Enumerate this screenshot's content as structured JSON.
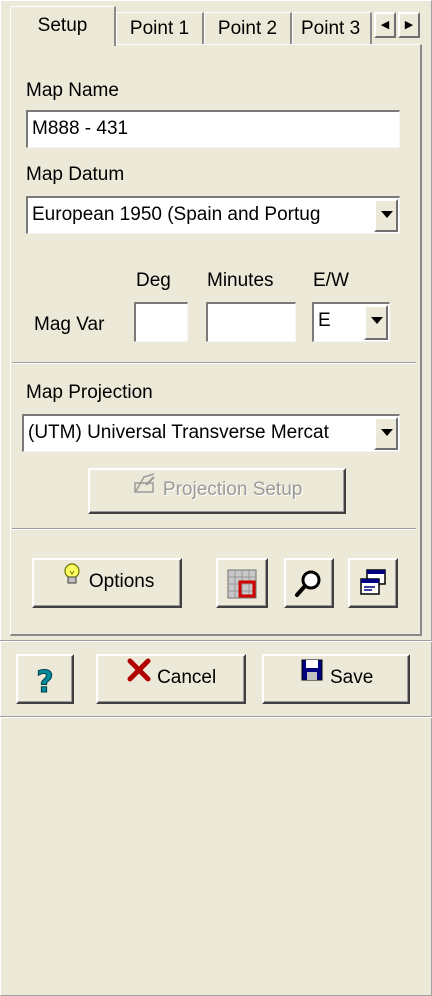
{
  "tabs": [
    "Setup",
    "Point 1",
    "Point 2",
    "Point 3"
  ],
  "setup": {
    "map_name_label": "Map Name",
    "map_name_value": "M888 - 431",
    "map_datum_label": "Map Datum",
    "map_datum_value": "European 1950 (Spain and Portug",
    "deg_label": "Deg",
    "minutes_label": "Minutes",
    "ew_label": "E/W",
    "mag_var_label": "Mag Var",
    "deg_value": "",
    "minutes_value": "",
    "ew_value": "E",
    "map_projection_label": "Map Projection",
    "map_projection_value": "(UTM) Universal Transverse Mercat",
    "projection_setup_label": "Projection Setup",
    "options_label": "Options"
  },
  "footer": {
    "cancel_label": "Cancel",
    "save_label": "Save"
  },
  "icons": {
    "options": "lightbulb-icon",
    "grid": "grid-icon",
    "zoom": "magnifier-icon",
    "windows": "windows-icon",
    "help": "help-icon",
    "cancel": "cancel-x-icon",
    "save": "save-floppy-icon"
  }
}
